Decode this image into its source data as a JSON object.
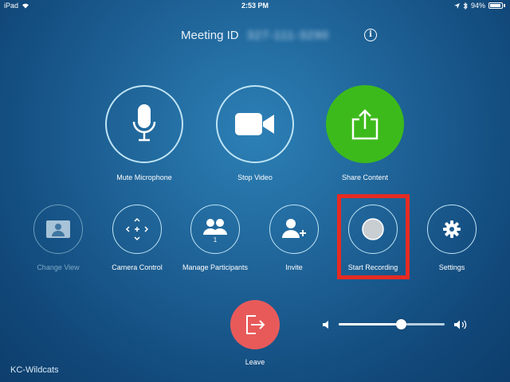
{
  "status_bar": {
    "device": "iPad",
    "time": "2:53 PM",
    "battery": "94%"
  },
  "meeting": {
    "label": "Meeting ID",
    "id": "327-111-3290",
    "info_symbol": "i"
  },
  "primary_controls": [
    {
      "label": "Mute Microphone",
      "icon": "microphone-icon"
    },
    {
      "label": "Stop Video",
      "icon": "video-camera-icon"
    },
    {
      "label": "Share Content",
      "icon": "share-icon"
    }
  ],
  "secondary_controls": [
    {
      "label": "Change View",
      "icon": "gallery-view-icon",
      "enabled": false
    },
    {
      "label": "Camera Control",
      "icon": "camera-control-icon",
      "enabled": true
    },
    {
      "label": "Manage Participants",
      "icon": "participants-icon",
      "badge": "1",
      "enabled": true
    },
    {
      "label": "Invite",
      "icon": "add-person-icon",
      "enabled": true
    },
    {
      "label": "Start Recording",
      "icon": "record-icon",
      "enabled": true,
      "highlighted": true
    },
    {
      "label": "Settings",
      "icon": "gear-icon",
      "enabled": true
    }
  ],
  "leave": {
    "label": "Leave",
    "icon": "leave-icon"
  },
  "volume": {
    "level": 0.59
  },
  "room_name": "KC-Wildcats",
  "colors": {
    "share_green": "#3dba1b",
    "leave_red": "#e85a5a",
    "highlight_red": "#e62b22",
    "ring": "#bfe4f5"
  }
}
